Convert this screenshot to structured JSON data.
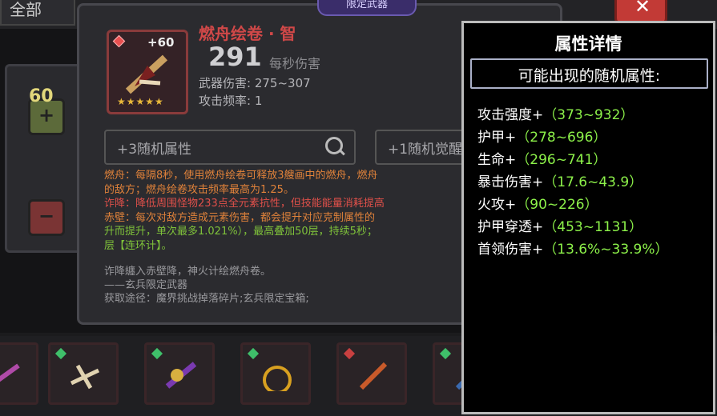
{
  "header": {
    "tab_label": "全部",
    "close_label": "✕"
  },
  "left_panel": {
    "plus_label": "+",
    "minus_label": "−",
    "quantity": "60"
  },
  "item": {
    "banner": "限定武器",
    "level": "+60",
    "stars": "★★★★★",
    "name": "燃舟绘卷 · 智",
    "dps_value": "291",
    "dps_label": "每秒伤害",
    "weapon_damage": "武器伤害: 275~307",
    "attack_rate": "攻击频率: 1",
    "random_attr_search": "+3随机属性",
    "random_awaken_search": "+1随机觉醒",
    "desc_lines": [
      {
        "text": "燃舟：每隔8秒，使用燃舟绘卷可释放3艘画中的燃舟，燃舟",
        "color": "orange"
      },
      {
        "text": "的敌方；燃舟绘卷攻击频率最高为1.25。",
        "color": "orange"
      },
      {
        "text": "诈降：降低周围怪物233点全元素抗性，但技能能量消耗提高",
        "color": "red"
      },
      {
        "text": "赤壁：每次对敌方造成元素伤害，都会提升对应克制属性的",
        "color": "orange"
      },
      {
        "text": "升而提升，单次最多1.021%），最高叠加50层，持续5秒；",
        "color": "green"
      },
      {
        "text": "层【连环计】。",
        "color": "green"
      }
    ],
    "flavor_lines": [
      "诈降纏入赤壁降，神火计绘燃舟卷。",
      "——玄兵限定武器",
      "获取途径：魔界挑战掉落碎片;玄兵限定宝箱;"
    ]
  },
  "attr_popup": {
    "title": "属性详情",
    "subtitle": "可能出现的随机属性:",
    "attributes": [
      {
        "name": "攻击强度+",
        "range": "（373~932）"
      },
      {
        "name": "护甲+",
        "range": "（278~696）"
      },
      {
        "name": "生命+",
        "range": "（296~741）"
      },
      {
        "name": "暴击伤害+",
        "range": "（17.6~43.9）"
      },
      {
        "name": "火攻+",
        "range": "（90~226）"
      },
      {
        "name": "护甲穿透+",
        "range": "（453~1131）"
      },
      {
        "name": "首领伤害+",
        "range": "（13.6%~33.9%）"
      }
    ]
  },
  "colors": {
    "accent_red": "#d04848",
    "attr_green": "#8df24a",
    "desc_orange": "#e0823a",
    "desc_green": "#7fc23a",
    "banner_purple": "#3a2d6a"
  },
  "icons": [
    "close-icon",
    "plus-icon",
    "minus-icon",
    "search-icon",
    "weapon-scroll-icon",
    "star-icon",
    "gem-icon"
  ]
}
